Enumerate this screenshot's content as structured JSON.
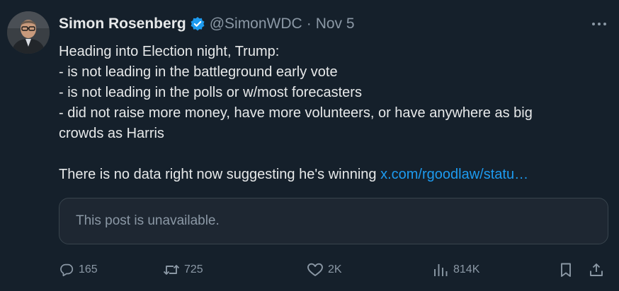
{
  "author": {
    "name": "Simon Rosenberg",
    "handle": "@SimonWDC",
    "separator": "·",
    "date": "Nov 5"
  },
  "post": {
    "lines": [
      "Heading into Election night, Trump:",
      "- is not leading in the battleground early vote",
      "- is not leading in the polls or w/most forecasters",
      "- did not raise more money, have more volunteers, or have anywhere as big",
      "crowds as Harris"
    ],
    "closing_text": "There is no data right now suggesting he's winning ",
    "link_text": "x.com/rgoodlaw/statu…"
  },
  "quoted": {
    "message": "This post is unavailable."
  },
  "actions": {
    "replies": "165",
    "reposts": "725",
    "likes": "2K",
    "views": "814K"
  },
  "colors": {
    "background": "#15202b",
    "text": "#e7e9ea",
    "muted": "#8b98a5",
    "link": "#1d9bf0",
    "verified": "#1d9bf0"
  },
  "icons": [
    "verified-badge-icon",
    "more-options-icon",
    "reply-icon",
    "repost-icon",
    "like-icon",
    "views-icon",
    "bookmark-icon",
    "share-icon"
  ]
}
